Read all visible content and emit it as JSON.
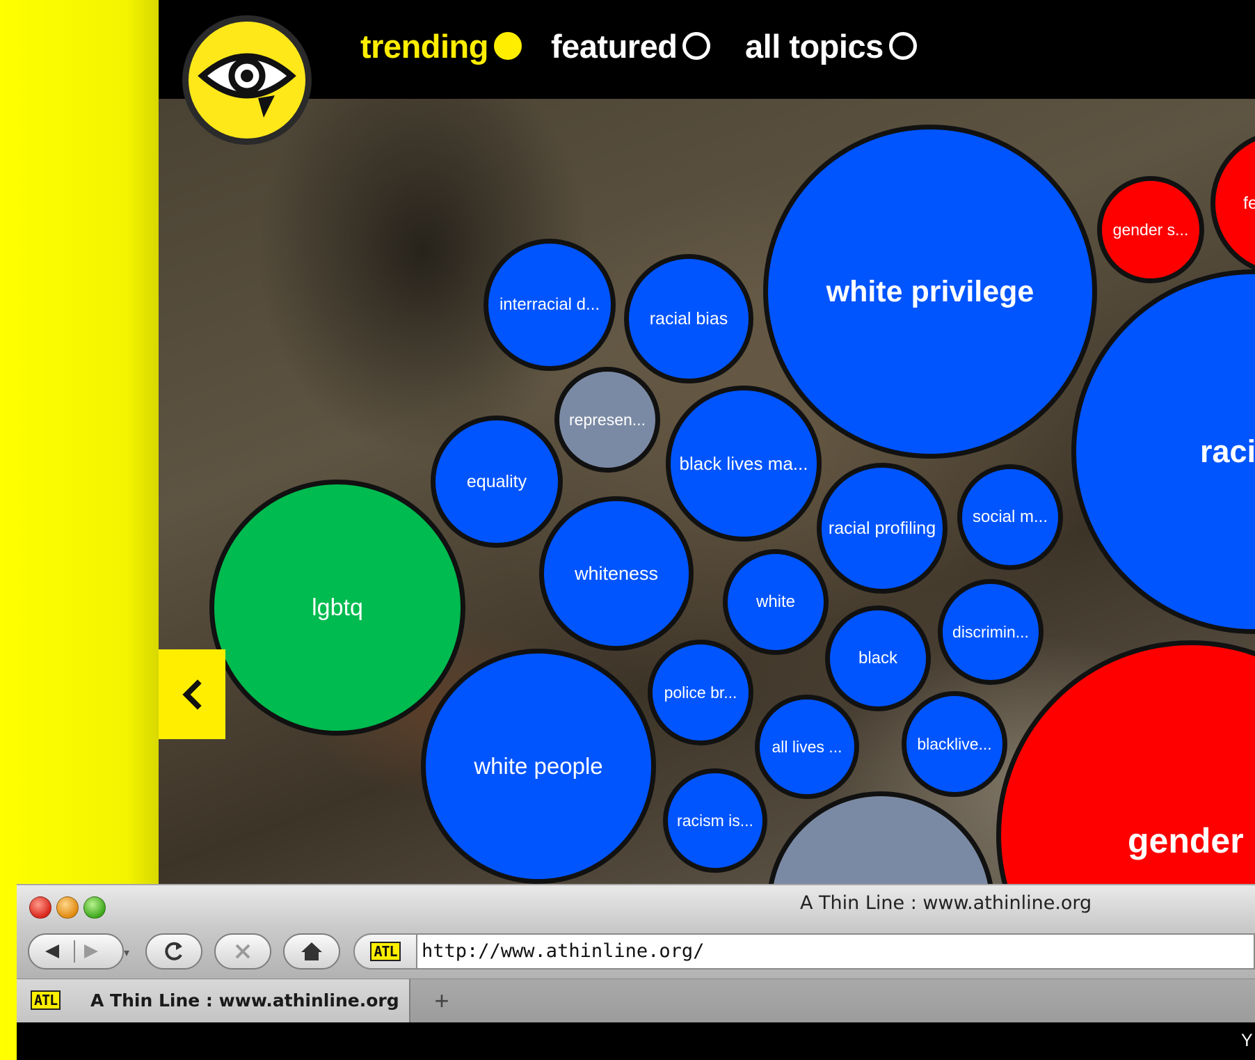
{
  "nav": {
    "items": [
      {
        "label": "trending",
        "active": true
      },
      {
        "label": "featured",
        "active": false
      },
      {
        "label": "all topics",
        "active": false
      }
    ]
  },
  "colors": {
    "brand_yellow": "#ffee00",
    "blue_topic": "#0055ff",
    "green_topic": "#00bb4f",
    "red_topic": "#ff0000",
    "grey_topic": "#7b8aa4"
  },
  "bubbles": [
    {
      "label": "white privilege",
      "category": "blue"
    },
    {
      "label": "interracial d...",
      "category": "blue"
    },
    {
      "label": "racial bias",
      "category": "blue"
    },
    {
      "label": "represen...",
      "category": "grey"
    },
    {
      "label": "equality",
      "category": "blue"
    },
    {
      "label": "black lives ma...",
      "category": "blue"
    },
    {
      "label": "lgbtq",
      "category": "green"
    },
    {
      "label": "whiteness",
      "category": "blue"
    },
    {
      "label": "racial profiling",
      "category": "blue"
    },
    {
      "label": "social m...",
      "category": "blue"
    },
    {
      "label": "white",
      "category": "blue"
    },
    {
      "label": "black",
      "category": "blue"
    },
    {
      "label": "discrimin...",
      "category": "blue"
    },
    {
      "label": "police br...",
      "category": "blue"
    },
    {
      "label": "white people",
      "category": "blue"
    },
    {
      "label": "all lives ...",
      "category": "blue"
    },
    {
      "label": "blacklive...",
      "category": "blue"
    },
    {
      "label": "racism is...",
      "category": "blue"
    },
    {
      "label": "gender s...",
      "category": "red"
    },
    {
      "label": "fe",
      "category": "red"
    },
    {
      "label": "raci",
      "category": "blue"
    },
    {
      "label": "gender",
      "category": "red"
    },
    {
      "label": "",
      "category": "grey"
    }
  ],
  "browser": {
    "window_title": "A Thin Line : www.athinline.org",
    "url": "http://www.athinline.org/",
    "site_badge": "ATL",
    "tab_title": "A Thin Line : www.athinline.org",
    "new_tab": "+",
    "status_fragment": "Y"
  }
}
